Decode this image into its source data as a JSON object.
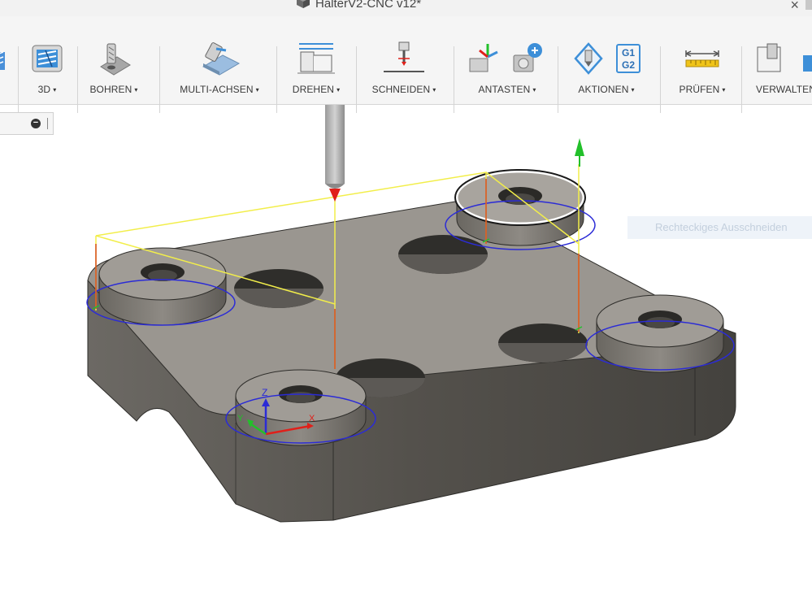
{
  "window": {
    "title": "HalterV2-CNC v12*",
    "close_glyph": "×",
    "doc_icon": "cube-icon"
  },
  "toolbar": {
    "groups": [
      {
        "label": "3D",
        "icon": "3d-milling-icon"
      },
      {
        "label": "BOHREN",
        "icon": "drill-icon"
      },
      {
        "label": "MULTI-ACHSEN",
        "icon": "multi-axis-icon"
      },
      {
        "label": "DREHEN",
        "icon": "turning-icon"
      },
      {
        "label": "SCHNEIDEN",
        "icon": "cutting-icon"
      },
      {
        "label": "ANTASTEN",
        "icon": "probing-icon"
      },
      {
        "label": "AKTIONEN",
        "icon": "actions-icon"
      },
      {
        "label": "PRÜFEN",
        "icon": "inspect-icon"
      },
      {
        "label": "VERWALTEN",
        "icon": "manage-icon"
      }
    ],
    "dropdown_caret": "▾",
    "gcode_icon_text": {
      "line1": "G1",
      "line2": "G2"
    }
  },
  "browser": {
    "collapse_glyph": "−"
  },
  "viewport": {
    "hint_text": "Rechteckiges Ausschneiden",
    "triad_labels": {
      "z": "Z",
      "x": "X",
      "y": "Y"
    },
    "colors": {
      "part_top": "#9a9690",
      "part_side": "#5a5751",
      "boss": "#a09c96",
      "toolpath": "#f2ee4a",
      "contour": "#2b2bd6",
      "lead": "#d64a1e",
      "arrow_green": "#22c02a",
      "arrow_red": "#e0201a"
    }
  }
}
